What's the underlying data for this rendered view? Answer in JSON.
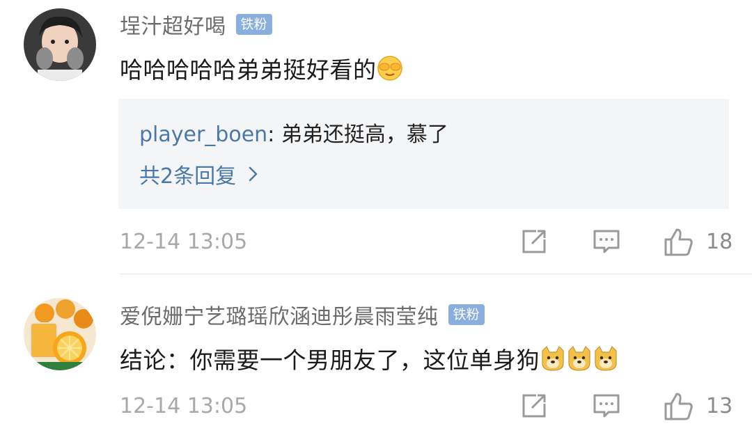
{
  "comments": [
    {
      "username": "埕汁超好喝",
      "badge": "铁粉",
      "text": "哈哈哈哈哈弟弟挺好看的",
      "emoji": "covering-eyes-face-emoji",
      "reply": {
        "user": "player_boen",
        "separator": ": ",
        "text": "弟弟还挺高，慕了",
        "count_label": "共2条回复"
      },
      "timestamp": "12-14 13:05",
      "likes": "18"
    },
    {
      "username": "爱倪姗宁艺璐瑶欣涵迪彤晨雨莹纯",
      "badge": "铁粉",
      "text": "结论：你需要一个男朋友了，这位单身狗",
      "emoji": "doge-emoji",
      "timestamp": "12-14 13:05",
      "likes": "13"
    }
  ],
  "colors": {
    "badge": "#8aaede",
    "link": "#4a78a8",
    "reply_bg": "#f4f5f7"
  }
}
